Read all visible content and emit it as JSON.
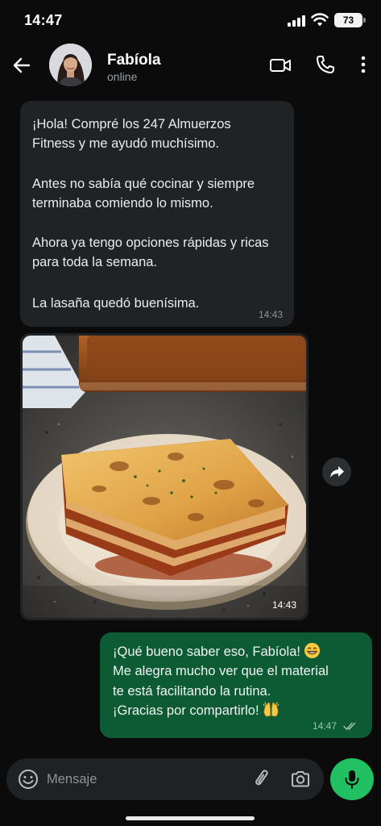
{
  "status_bar": {
    "time": "14:47",
    "battery_level": "73",
    "battery_fraction": 0.73
  },
  "header": {
    "contact_name": "Fabíola",
    "contact_status": "online",
    "icons": [
      "back-arrow-icon",
      "video-call-icon",
      "phone-icon",
      "more-options-icon"
    ]
  },
  "chat": {
    "incoming_message": {
      "paragraphs": [
        "¡Hola! Compré los 247 Almuerzos Fitness y me ayudó muchísimo.",
        "Antes no sabía qué cocinar y siempre terminaba comiendo lo mismo.",
        "Ahora ya tengo opciones rápidas y ricas para toda la semana.",
        "La lasaña quedó buenísima."
      ],
      "time": "14:43"
    },
    "photo_message": {
      "image": "lasagna-photo",
      "time": "14:43"
    },
    "outgoing_message": {
      "lines": [
        "¡Qué bueno saber eso, Fabíola!",
        "Me alegra mucho ver que el material",
        "te está facilitando la rutina.",
        "¡Gracias por compartirlo!"
      ],
      "emojis": [
        "grinning-face-emoji",
        "raising-hands-emoji"
      ],
      "time": "14:47",
      "read_status": "double-check-icon"
    }
  },
  "composer": {
    "placeholder": "Mensaje",
    "icons": [
      "emoji-icon",
      "attach-icon",
      "camera-icon",
      "mic-icon"
    ]
  },
  "colors": {
    "background": "#0b0b0b",
    "incoming_bubble": "#1f2326",
    "outgoing_bubble": "#0c5b35",
    "accent": "#21c063",
    "secondary_text": "#8d9498"
  }
}
